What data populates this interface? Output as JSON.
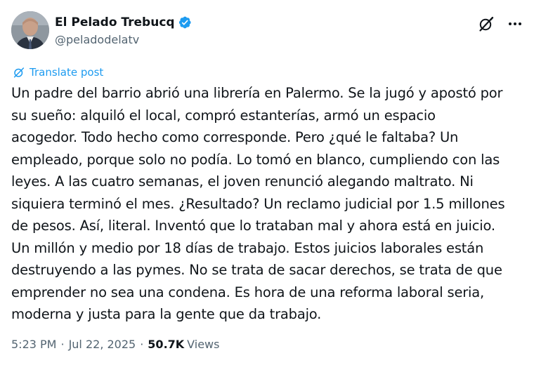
{
  "author": {
    "display_name": "El Pelado Trebucq",
    "handle": "@peladodelatv",
    "verified": true
  },
  "icons": {
    "verified": "verified-badge-icon",
    "grok": "grok-icon",
    "more": "more-options-icon",
    "translate": "translate-icon"
  },
  "colors": {
    "accent": "#1d9bf0",
    "text": "#0f1419",
    "secondary": "#536471"
  },
  "translate_label": "Translate post",
  "post_lines": [
    "Un padre del barrio abrió una librería en Palermo. Se la jugó y apostó por",
    "su sueño: alquiló el local, compró estanterías, armó un espacio",
    "acogedor. Todo hecho como corresponde. Pero ¿qué le faltaba? Un",
    "empleado, porque solo no podía. Lo tomó en blanco, cumpliendo con las",
    "leyes. A las cuatro semanas, el joven renunció alegando maltrato. Ni",
    "siquiera terminó el mes. ¿Resultado? Un reclamo judicial por 1.5 millones",
    "de pesos. Así, literal. Inventó que lo trataban mal y ahora está en juicio.",
    "Un millón y medio por 18 días de trabajo. Estos juicios laborales están",
    "destruyendo a las pymes. No se trata de sacar derechos, se trata de que",
    "emprender no sea una condena. Es hora de una reforma laboral seria,",
    "moderna y justa para la gente que da trabajo."
  ],
  "meta": {
    "time": "5:23 PM",
    "separator": "·",
    "date": "Jul 22, 2025",
    "views_count": "50.7K",
    "views_label": "Views"
  }
}
